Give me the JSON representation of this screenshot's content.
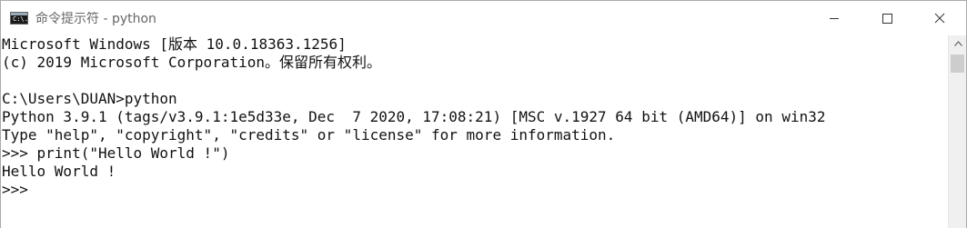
{
  "window": {
    "title": "命令提示符 - python",
    "icon_text": "C:\\.",
    "icon": "cmd-icon",
    "controls": [
      "minimize-icon",
      "maximize-icon",
      "close-icon"
    ]
  },
  "console": {
    "lines": [
      "Microsoft Windows [版本 10.0.18363.1256]",
      "(c) 2019 Microsoft Corporation。保留所有权利。",
      "",
      "C:\\Users\\DUAN>python",
      "Python 3.9.1 (tags/v3.9.1:1e5d33e, Dec  7 2020, 17:08:21) [MSC v.1927 64 bit (AMD64)] on win32",
      "Type \"help\", \"copyright\", \"credits\" or \"license\" for more information.",
      ">>> print(\"Hello World !\")",
      "Hello World !",
      ">>> "
    ]
  },
  "colors": {
    "text": "#111111",
    "background": "#ffffff",
    "title_text": "#666666",
    "scrollbar_track": "#f0f0f0",
    "scrollbar_thumb": "#cdcdcd"
  }
}
